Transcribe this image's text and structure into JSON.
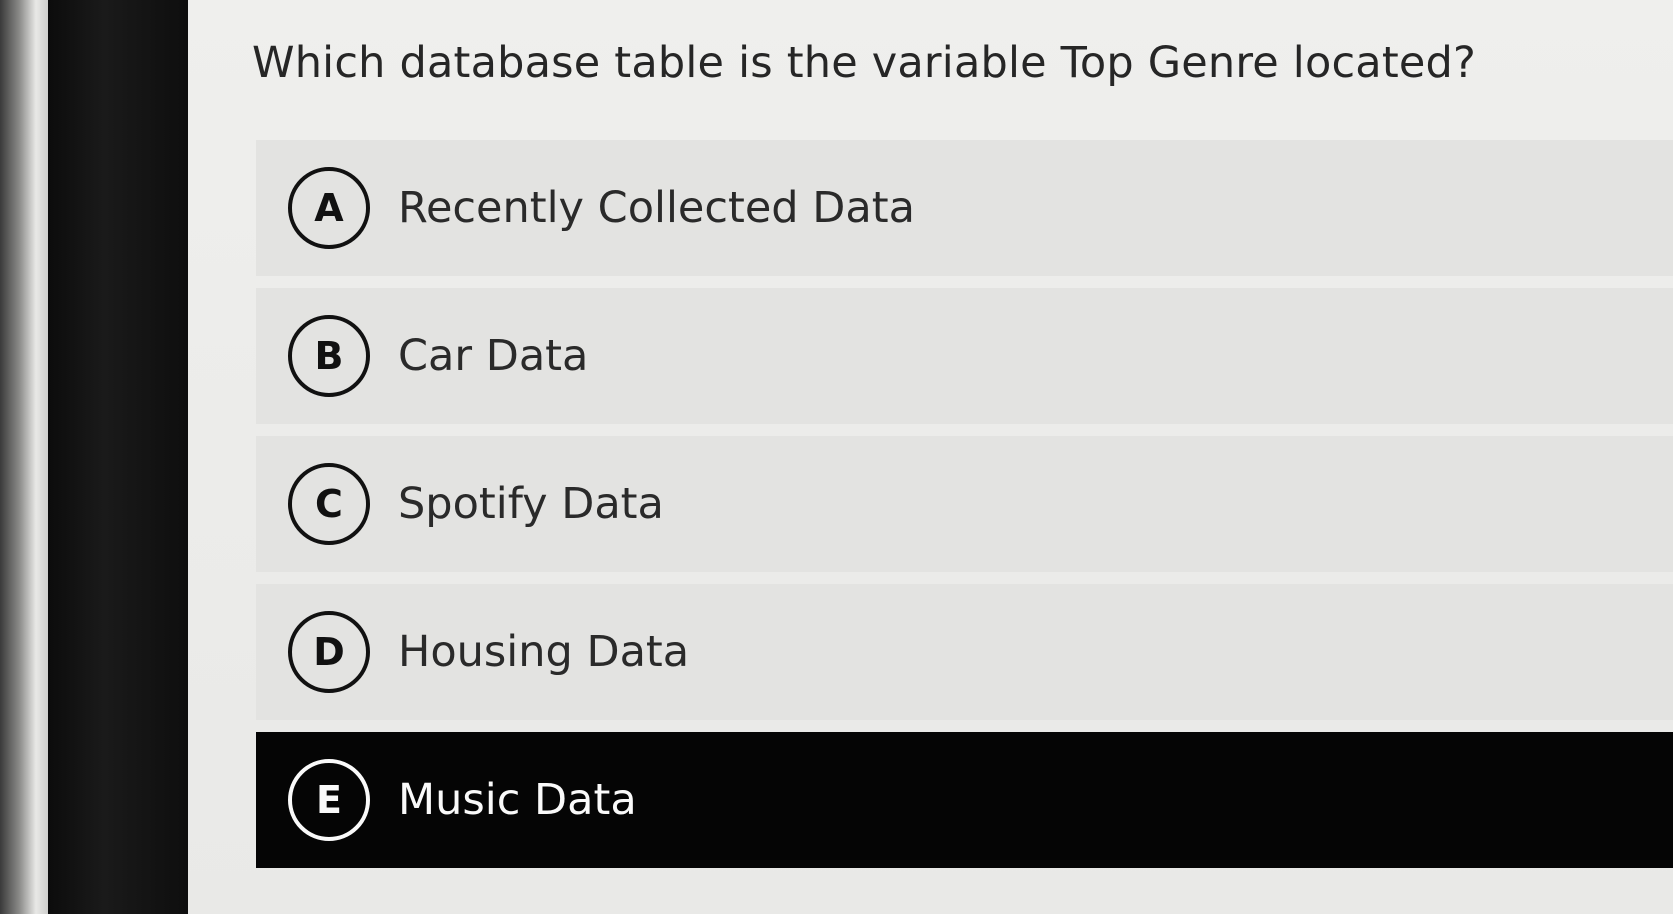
{
  "question": {
    "text": "Which database table is the variable Top Genre located?"
  },
  "options": [
    {
      "letter": "A",
      "label": "Recently Collected Data",
      "selected": false
    },
    {
      "letter": "B",
      "label": "Car Data",
      "selected": false
    },
    {
      "letter": "C",
      "label": "Spotify Data",
      "selected": false
    },
    {
      "letter": "D",
      "label": "Housing Data",
      "selected": false
    },
    {
      "letter": "E",
      "label": "Music Data",
      "selected": true
    }
  ],
  "colors": {
    "background": "#ececea",
    "option_background": "#e3e3e1",
    "selected_background": "#050505",
    "text": "#262626",
    "selected_text": "#fafafa"
  }
}
